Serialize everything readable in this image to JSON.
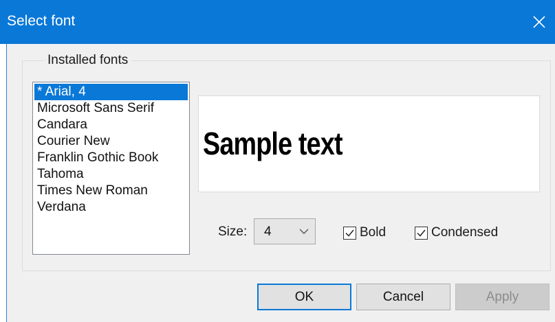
{
  "window": {
    "title": "Select font",
    "close_glyph": "✕",
    "accent_color": "#0a78d7"
  },
  "group": {
    "legend": "Installed fonts"
  },
  "font_list": {
    "items": [
      "* Arial, 4",
      "Microsoft Sans Serif",
      "Candara",
      "Courier New",
      "Franklin Gothic Book",
      "Tahoma",
      "Times New Roman",
      "Verdana"
    ],
    "selected_index": 0
  },
  "preview": {
    "text": "Sample text"
  },
  "size": {
    "label": "Size:",
    "value": "4"
  },
  "options": {
    "bold_label": "Bold",
    "bold_checked": true,
    "condensed_label": "Condensed",
    "condensed_checked": true
  },
  "buttons": {
    "ok": "OK",
    "cancel": "Cancel",
    "apply": "Apply"
  },
  "icons": {
    "close": "close-icon",
    "dropdown": "chevron-down-icon",
    "check": "checkmark-icon"
  }
}
